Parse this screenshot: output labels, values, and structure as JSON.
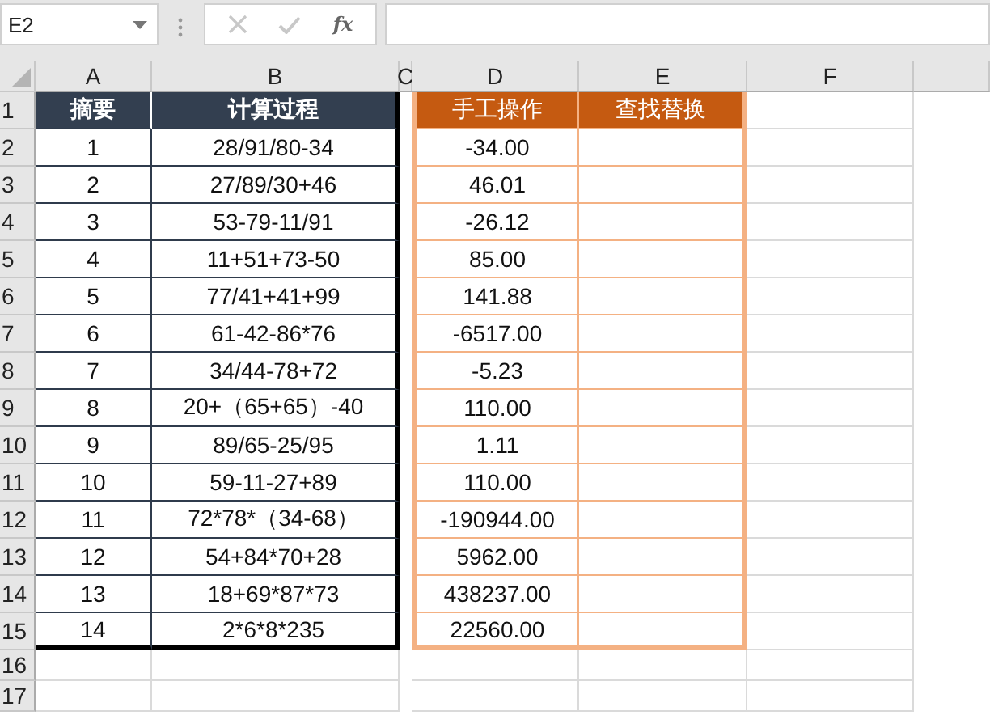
{
  "name_box": {
    "value": "E2"
  },
  "formula_bar": {
    "function_label": "fx"
  },
  "column_headers": [
    "A",
    "B",
    "C",
    "D",
    "E",
    "F"
  ],
  "row_headers": [
    "1",
    "2",
    "3",
    "4",
    "5",
    "6",
    "7",
    "8",
    "9",
    "10",
    "11",
    "12",
    "13",
    "14",
    "15",
    "16",
    "17"
  ],
  "left_table": {
    "columns": [
      "摘要",
      "计算过程"
    ],
    "rows": [
      [
        "1",
        "28/91/80-34"
      ],
      [
        "2",
        "27/89/30+46"
      ],
      [
        "3",
        "53-79-11/91"
      ],
      [
        "4",
        "11+51+73-50"
      ],
      [
        "5",
        "77/41+41+99"
      ],
      [
        "6",
        "61-42-86*76"
      ],
      [
        "7",
        "34/44-78+72"
      ],
      [
        "8",
        "20+（65+65）-40"
      ],
      [
        "9",
        "89/65-25/95"
      ],
      [
        "10",
        "59-11-27+89"
      ],
      [
        "11",
        "72*78*（34-68）"
      ],
      [
        "12",
        "54+84*70+28"
      ],
      [
        "13",
        "18+69*87*73"
      ],
      [
        "14",
        "2*6*8*235"
      ]
    ]
  },
  "right_table": {
    "columns": [
      "手工操作",
      "查找替换"
    ],
    "rows": [
      [
        "-34.00"
      ],
      [
        "46.01"
      ],
      [
        "-26.12"
      ],
      [
        "85.00"
      ],
      [
        "141.88"
      ],
      [
        "-6517.00"
      ],
      [
        "-5.23"
      ],
      [
        "110.00"
      ],
      [
        "1.11"
      ],
      [
        "110.00"
      ],
      [
        "-190944.00"
      ],
      [
        "5962.00"
      ],
      [
        "438237.00"
      ],
      [
        "22560.00"
      ]
    ]
  }
}
